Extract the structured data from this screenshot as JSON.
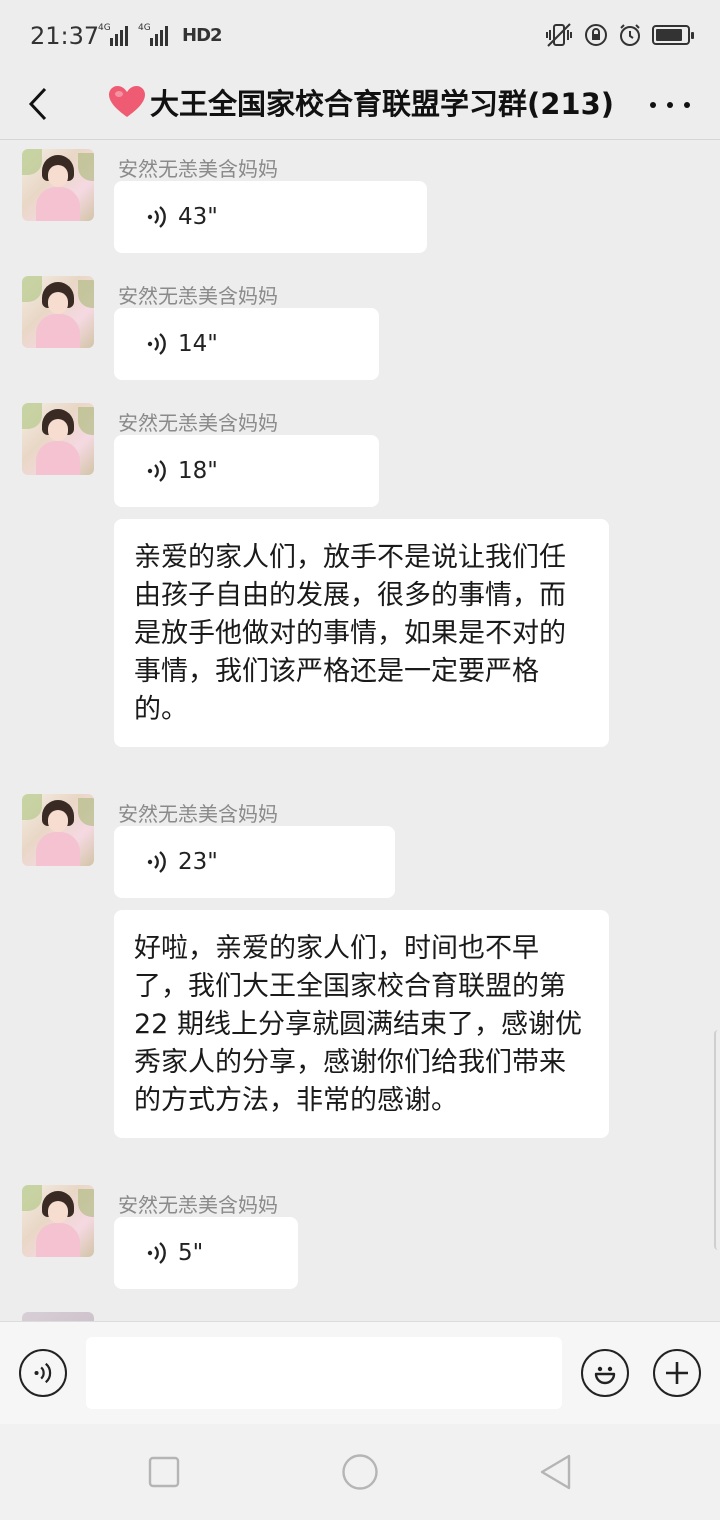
{
  "status_bar": {
    "time": "21:37",
    "network_1": "4G",
    "network_2": "4G",
    "hd_label": "HD2",
    "battery_level": 0.85
  },
  "header": {
    "title": "大王全国家校合育联盟学习群(213)",
    "heart_color": "#ef5b72"
  },
  "messages": [
    {
      "type": "voice",
      "sender": "安然无恙美含妈妈",
      "duration": "43\""
    },
    {
      "type": "voice",
      "sender": "安然无恙美含妈妈",
      "duration": "14\""
    },
    {
      "type": "voice",
      "sender": "安然无恙美含妈妈",
      "duration": "18\""
    },
    {
      "type": "text",
      "text": "亲爱的家人们，放手不是说让我们任由孩子自由的发展，很多的事情，而是放手他做对的事情，如果是不对的事情，我们该严格还是一定要严格的。"
    },
    {
      "type": "voice",
      "sender": "安然无恙美含妈妈",
      "duration": "23\""
    },
    {
      "type": "text",
      "text": "好啦，亲爱的家人们，时间也不早了，我们大王全国家校合育联盟的第 22 期线上分享就圆满结束了，感谢优秀家人的分享，感谢你们给我们带来的方式方法，非常的感谢。"
    },
    {
      "type": "voice",
      "sender": "安然无恙美含妈妈",
      "duration": "5\""
    }
  ],
  "input_bar": {
    "placeholder": ""
  }
}
